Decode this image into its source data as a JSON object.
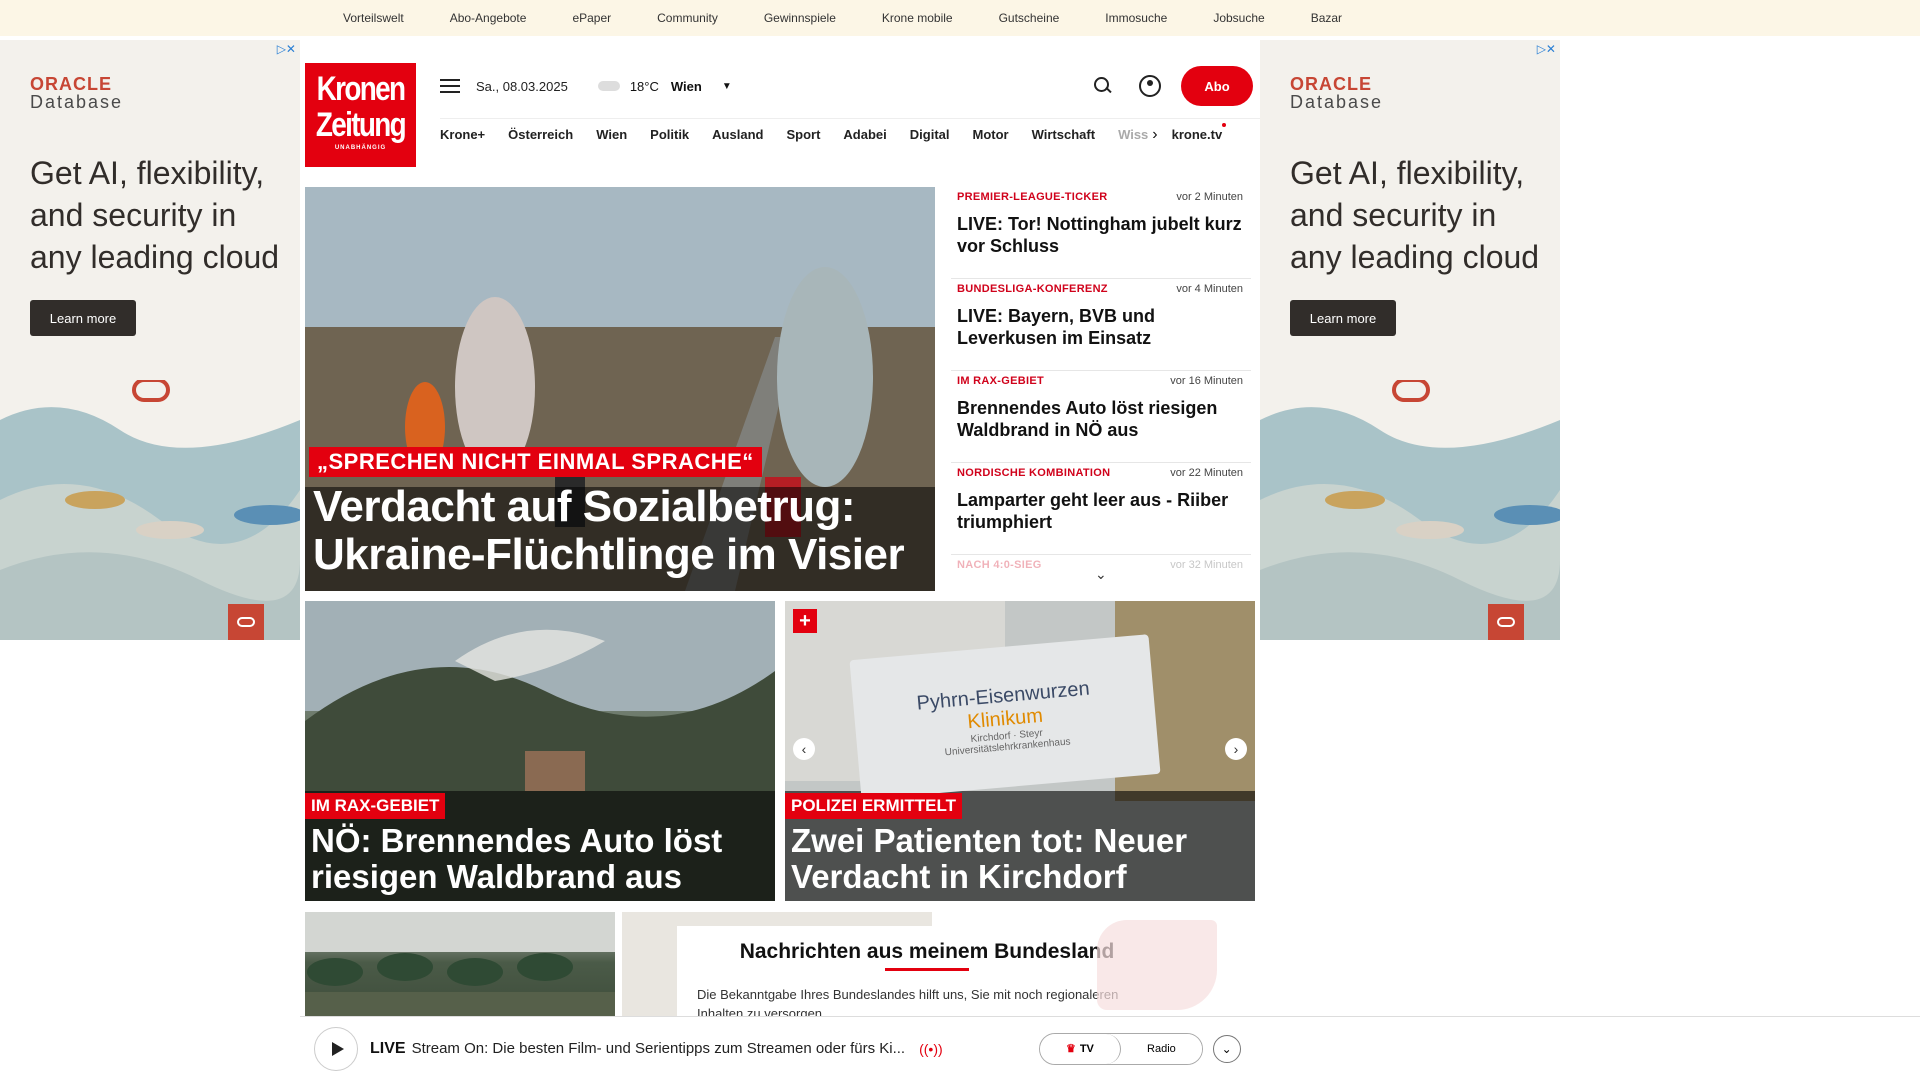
{
  "topnav": [
    "Vorteilswelt",
    "Abo-Angebote",
    "ePaper",
    "Community",
    "Gewinnspiele",
    "Krone mobile",
    "Gutscheine",
    "Immosuche",
    "Jobsuche",
    "Bazar"
  ],
  "ad": {
    "brand_top": "ORACLE",
    "brand_bottom": "Database",
    "headline": "Get AI, flexibility, and security in any leading cloud",
    "cta": "Learn more",
    "corner": "▷✕",
    "colors": {
      "brand": "#c74634",
      "dark": "#312d2a"
    }
  },
  "logo": {
    "line1": "Kronen",
    "line2": "Zeitung",
    "tagline": "UNABHÄNGIG"
  },
  "header": {
    "date": "Sa., 08.03.2025",
    "temperature": "18°C",
    "city": "Wien",
    "abo": "Abo"
  },
  "nav": {
    "items": [
      "Krone+",
      "Österreich",
      "Wien",
      "Politik",
      "Ausland",
      "Sport",
      "Adabei",
      "Digital",
      "Motor",
      "Wirtschaft"
    ],
    "truncated": "Wiss",
    "tv": "krone.tv"
  },
  "hero": {
    "kicker": "„SPRECHEN NICHT EINMAL SPRACHE“",
    "title": "Verdacht auf Sozialbetrug: Ukraine-Flüchtlinge im Visier"
  },
  "ticker": [
    {
      "kicker": "PREMIER-LEAGUE-TICKER",
      "time": "vor 2 Minuten",
      "title": "LIVE: Tor! Nottingham jubelt kurz vor Schluss"
    },
    {
      "kicker": "BUNDESLIGA-KONFERENZ",
      "time": "vor 4 Minuten",
      "title": "LIVE: Bayern, BVB und Leverkusen im Einsatz"
    },
    {
      "kicker": "IM RAX-GEBIET",
      "time": "vor 16 Minuten",
      "title": "Brennendes Auto löst riesigen Waldbrand in NÖ aus"
    },
    {
      "kicker": "NORDISCHE KOMBINATION",
      "time": "vor 22 Minuten",
      "title": "Lamparter geht leer aus - Riiber triumphiert"
    },
    {
      "kicker": "NACH 4:0-SIEG",
      "time": "vor 32 Minuten",
      "title": ""
    }
  ],
  "cards": [
    {
      "kicker": "IM RAX-GEBIET",
      "title": "NÖ: Brennendes Auto löst riesigen Waldbrand aus"
    },
    {
      "kicker": "POLIZEI ERMITTELT",
      "title": "Zwei Patienten tot: Neuer Verdacht in Kirchdorf",
      "sign": {
        "l1": "Pyhrn-Eisenwurzen",
        "l2": "Klinikum",
        "l3": "Kirchdorf · Steyr",
        "l4": "Universitätslehrkrankenhaus"
      }
    }
  ],
  "bundesland": {
    "title": "Nachrichten aus meinem Bundesland",
    "text": "Die Bekanntgabe Ihres Bundeslandes hilft uns, Sie mit noch regionaleren Inhalten zu versorgen."
  },
  "player": {
    "live": "LIVE",
    "stream": "Stream On: Die besten Film- und Serientipps zum Streamen oder fürs Ki...",
    "tv": "TV",
    "radio": "Radio"
  }
}
